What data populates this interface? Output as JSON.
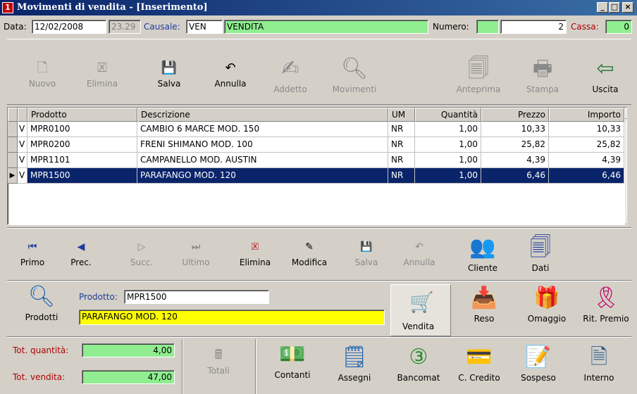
{
  "window": {
    "title": "Movimenti di vendita - [Inserimento]",
    "app_icon_text": "1",
    "min_label": "_",
    "max_label": "□",
    "close_label": "×"
  },
  "header": {
    "data_label": "Data:",
    "data_value": "12/02/2008",
    "time_value": "23.29",
    "causale_label": "Causale:",
    "causale_code": "VEN",
    "causale_desc": "VENDITA",
    "numero_label": "Numero:",
    "numero_prefix": "",
    "numero_value": "2",
    "cassa_label": "Cassa:",
    "cassa_value": "0"
  },
  "toolbar": {
    "nuovo": "Nuovo",
    "elimina": "Elimina",
    "salva": "Salva",
    "annulla": "Annulla",
    "addetto": "Addetto",
    "movimenti": "Movimenti",
    "anteprima": "Anteprima",
    "stampa": "Stampa",
    "uscita": "Uscita"
  },
  "grid": {
    "columns": [
      "Prodotto",
      "Descrizione",
      "UM",
      "Quantità",
      "Prezzo",
      "Importo"
    ],
    "rows": [
      {
        "flag": "V",
        "prodotto": "MPR0100",
        "descrizione": "CAMBIO 6 MARCE MOD. 150",
        "um": "NR",
        "quantita": "1,00",
        "prezzo": "10,33",
        "importo": "10,33"
      },
      {
        "flag": "V",
        "prodotto": "MPR0200",
        "descrizione": "FRENI SHIMANO MOD. 100",
        "um": "NR",
        "quantita": "1,00",
        "prezzo": "25,82",
        "importo": "25,82"
      },
      {
        "flag": "V",
        "prodotto": "MPR1101",
        "descrizione": "CAMPANELLO MOD. AUSTIN",
        "um": "NR",
        "quantita": "1,00",
        "prezzo": "4,39",
        "importo": "4,39"
      },
      {
        "flag": "V",
        "prodotto": "MPR1500",
        "descrizione": "PARAFANGO MOD. 120",
        "um": "NR",
        "quantita": "1,00",
        "prezzo": "6,46",
        "importo": "6,46"
      }
    ]
  },
  "nav": {
    "primo": "Primo",
    "prec": "Prec.",
    "succ": "Succ.",
    "ultimo": "Ultimo",
    "elimina": "Elimina",
    "modifica": "Modifica",
    "salva": "Salva",
    "annulla": "Annulla",
    "cliente": "Cliente",
    "dati": "Dati"
  },
  "product": {
    "prodotti_label": "Prodotti",
    "prodotto_label": "Prodotto:",
    "prodotto_value": "MPR1500",
    "descrizione_value": "PARAFANGO MOD. 120"
  },
  "actions": {
    "vendita": "Vendita",
    "reso": "Reso",
    "omaggio": "Omaggio",
    "rit_premio": "Rit. Premio"
  },
  "totals": {
    "qty_label": "Tot. quantità:",
    "qty_value": "4,00",
    "sale_label": "Tot. vendita:",
    "sale_value": "47,00",
    "totali": "Totali"
  },
  "payments": {
    "contanti": "Contanti",
    "assegni": "Assegni",
    "bancomat": "Bancomat",
    "c_credito": "C. Credito",
    "sospeso": "Sospeso",
    "interno": "Interno"
  },
  "colors": {
    "title_bar": "#0a246a",
    "selection": "#0a246a",
    "green_field": "#90ee90",
    "yellow_field": "#ffff00"
  }
}
